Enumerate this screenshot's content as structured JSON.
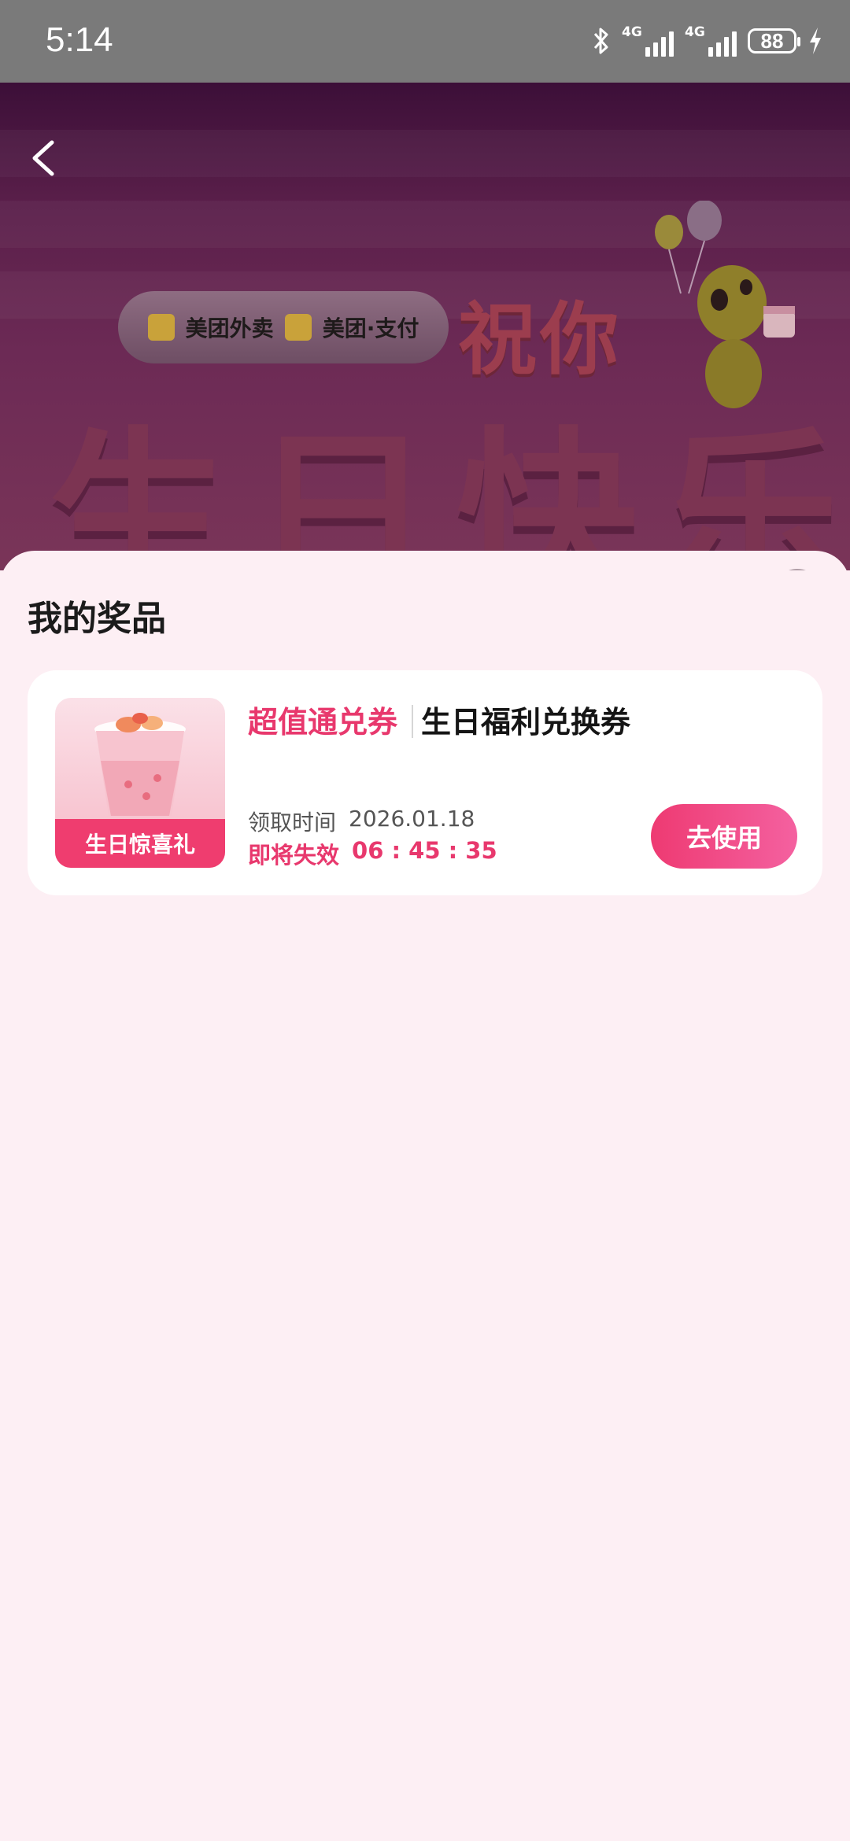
{
  "status_bar": {
    "time": "5:14",
    "network_1": "4G",
    "network_2": "4G",
    "battery": "88"
  },
  "hero": {
    "brand_1": "美团外卖",
    "brand_2": "美团·支付",
    "headline_small": "祝你",
    "headline_large": "生日快乐"
  },
  "sheet": {
    "title": "我的奖品",
    "prize": {
      "tag": "超值通兑券",
      "name": "生日福利兑换券",
      "thumb_label": "生日惊喜礼",
      "claim_label": "领取时间",
      "claim_date": "2026.01.18",
      "expire_label": "即将失效",
      "countdown": "06 : 45 : 35",
      "use_button": "去使用"
    }
  },
  "colors": {
    "accent": "#e8386d",
    "sheet_bg": "#fdeff4",
    "status_bar_bg": "#7a7a7a"
  },
  "icons": {
    "back": "back-chevron-icon",
    "close": "close-icon",
    "bluetooth": "bluetooth-icon",
    "charging": "charging-bolt-icon"
  }
}
